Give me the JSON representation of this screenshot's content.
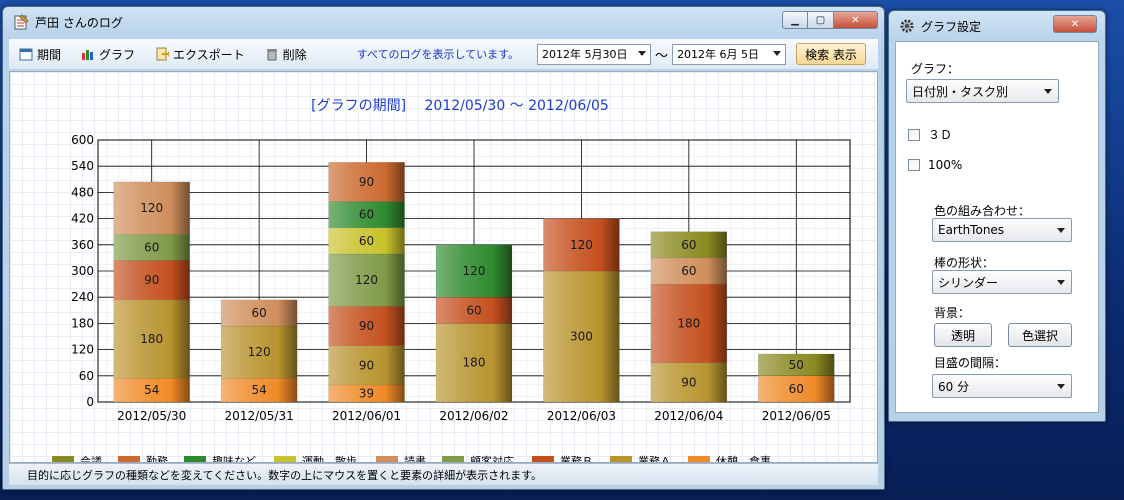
{
  "main_window": {
    "title": "芦田 さんのログ",
    "toolbar": {
      "period": "期間",
      "graph": "グラフ",
      "export": "エクスポート",
      "delete": "削除",
      "status": "すべてのログを表示しています。",
      "date_from": "2012年  5月30日",
      "tilde": "～",
      "date_to": "2012年  6月  5日",
      "search_button": "検索 表示"
    },
    "statusbar": "目的に応じグラフの種類などを変えてください。数字の上にマウスを置くと要素の詳細が表示されます。"
  },
  "settings_window": {
    "title": "グラフ設定",
    "graph_label": "グラフ：",
    "graph_value": "日付別・タスク別",
    "check_3d": "３Ｄ",
    "check_100": "100%",
    "color_label": "色の組み合わせ：",
    "color_value": "EarthTones",
    "shape_label": "棒の形状：",
    "shape_value": "シリンダー",
    "bg_label": "背景：",
    "transparent_button": "透明",
    "color_select_button": "色選択",
    "interval_label": "目盛の間隔：",
    "interval_value": "60 分"
  },
  "colors": {
    "会議": "#8a8a22",
    "勤務": "#cc6a30",
    "趣味など": "#2f8a2f",
    "運動": "#c8c22a",
    "読書": "#cf8e5c",
    "顧客対応": "#7f9a48",
    "業務B": "#c4501e",
    "業務A": "#b8942f",
    "休憩": "#f08a28"
  },
  "chart_data": {
    "type": "bar",
    "stacked": true,
    "title": "[グラフの期間]　 2012/05/30 ～ 2012/06/05",
    "ylim": [
      0,
      600
    ],
    "yticks": [
      0,
      60,
      120,
      180,
      240,
      300,
      360,
      420,
      480,
      540,
      600
    ],
    "grid": true,
    "legend": "bottom",
    "categories": [
      "2012/05/30",
      "2012/05/31",
      "2012/06/01",
      "2012/06/02",
      "2012/06/03",
      "2012/06/04",
      "2012/06/05"
    ],
    "series": [
      {
        "name": "休憩、食事",
        "color": "#f08a28",
        "values": [
          54,
          54,
          39,
          0,
          0,
          0,
          60
        ]
      },
      {
        "name": "業務Ａ",
        "color": "#b8942f",
        "values": [
          180,
          120,
          90,
          180,
          300,
          90,
          0
        ]
      },
      {
        "name": "業務Ｂ",
        "color": "#c4501e",
        "values": [
          90,
          0,
          90,
          60,
          120,
          180,
          0
        ]
      },
      {
        "name": "顧客対応",
        "color": "#7f9a48",
        "values": [
          60,
          0,
          120,
          0,
          0,
          0,
          0
        ]
      },
      {
        "name": "読書",
        "color": "#cf8e5c",
        "values": [
          120,
          60,
          0,
          0,
          0,
          60,
          0
        ]
      },
      {
        "name": "運動、散歩",
        "color": "#c8c22a",
        "values": [
          0,
          0,
          60,
          0,
          0,
          0,
          0
        ]
      },
      {
        "name": "趣味など",
        "color": "#2f8a2f",
        "values": [
          0,
          0,
          60,
          120,
          0,
          0,
          0
        ]
      },
      {
        "name": "勤務",
        "color": "#cc6a30",
        "values": [
          0,
          0,
          90,
          0,
          0,
          0,
          0
        ]
      },
      {
        "name": "会議",
        "color": "#8a8a22",
        "values": [
          0,
          0,
          0,
          0,
          0,
          60,
          50
        ]
      }
    ],
    "legend_entries": [
      "会議",
      "勤務",
      "趣味など",
      "運動、散歩",
      "読書",
      "顧客対応",
      "業務Ｂ",
      "業務Ａ",
      "休憩、食事"
    ]
  }
}
